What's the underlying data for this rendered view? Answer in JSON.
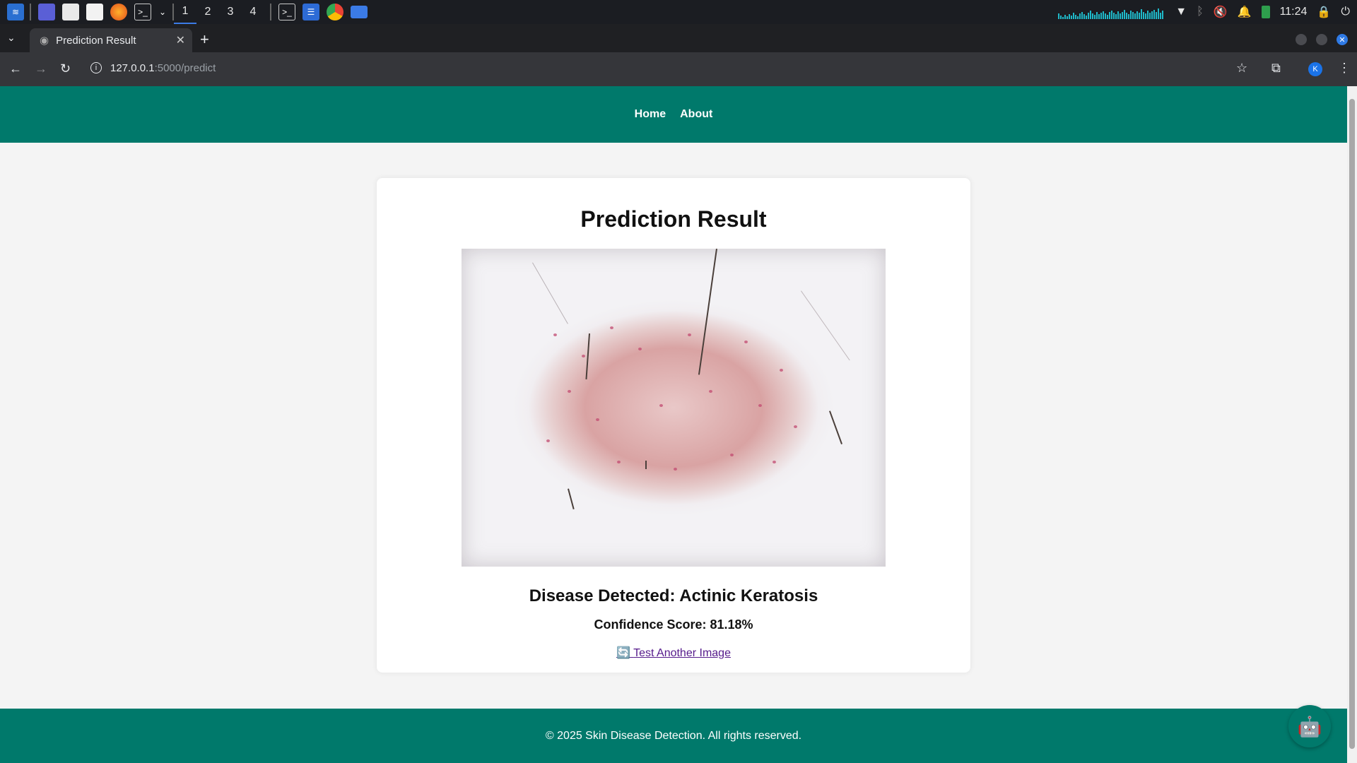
{
  "taskbar": {
    "workspaces": [
      "1",
      "2",
      "3",
      "4"
    ],
    "active_workspace": "1",
    "clock": "11:24"
  },
  "browser": {
    "tab_title": "Prediction Result",
    "url_host": "127.0.0.1",
    "url_path": ":5000/predict",
    "profile_initial": "K"
  },
  "nav": {
    "home": "Home",
    "about": "About"
  },
  "result": {
    "title": "Prediction Result",
    "disease": "Disease Detected: Actinic Keratosis",
    "confidence": "Confidence Score: 81.18%",
    "retry_icon": "🔄",
    "retry_label": "Test Another Image"
  },
  "footer": {
    "text": "© 2025 Skin Disease Detection. All rights reserved."
  },
  "colors": {
    "brand": "#00796b"
  }
}
